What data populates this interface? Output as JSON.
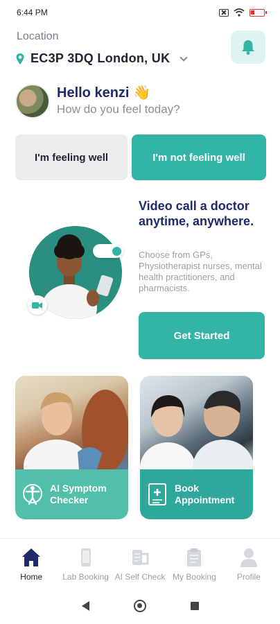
{
  "status_bar": {
    "time": "6:44 PM"
  },
  "location": {
    "label": "Location",
    "value": "EC3P 3DQ London, UK"
  },
  "greeting": {
    "hello": "Hello kenzi 👋",
    "question": "How do you feel today?"
  },
  "mood": {
    "well_label": "I'm feeling well",
    "not_well_label": "I'm not feeling well"
  },
  "promo": {
    "title": "Video call a doctor anytime, anywhere.",
    "description": "Choose from GPs, Physiotherapist nurses, mental health practitioners, and pharmacists.",
    "cta_label": "Get Started"
  },
  "cards": [
    {
      "label_line1": "AI Symptom",
      "label_line2": "Checker",
      "icon": "body-check-icon"
    },
    {
      "label_line1": "Book",
      "label_line2": "Appointment",
      "icon": "booking-icon"
    }
  ],
  "bottom_nav": [
    {
      "label": "Home",
      "icon": "home-icon",
      "active": true
    },
    {
      "label": "Lab Booking",
      "icon": "phone-icon",
      "active": false
    },
    {
      "label": "AI Self Check",
      "icon": "self-check-icon",
      "active": false
    },
    {
      "label": "My Booking",
      "icon": "clipboard-icon",
      "active": false
    },
    {
      "label": "Profile",
      "icon": "person-icon",
      "active": false
    }
  ],
  "colors": {
    "accent": "#33b5a6",
    "navy": "#1e2a6b",
    "card_green": "#52c0a8"
  }
}
